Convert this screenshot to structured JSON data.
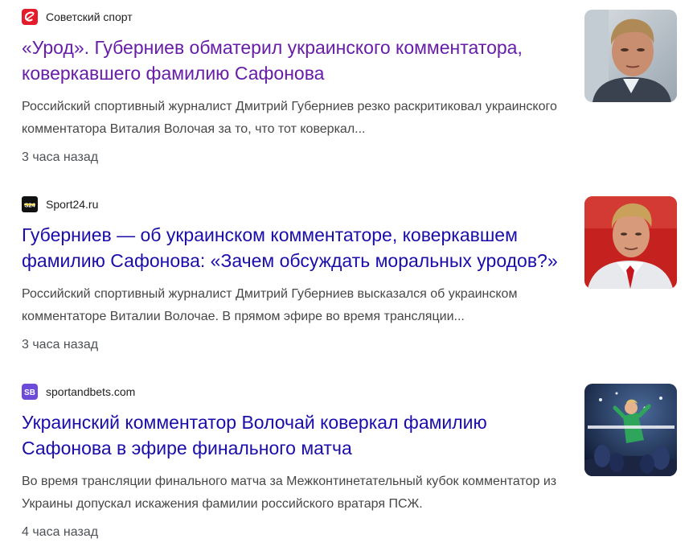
{
  "results": [
    {
      "source": "Советский спорт",
      "favicon_icon": "sovsport-icon",
      "favicon_color": "#e41b2b",
      "title": "«Урод». Губерниев обматерил украинского комментатора, коверкавшего фамилию Сафонова",
      "title_color": "#681da8",
      "snippet": "Российский спортивный журналист Дмитрий Губерниев резко раскритиковал украинского комментатора Виталия Волочая за то, что тот коверкал...",
      "time": "3 часа назад"
    },
    {
      "source": "Sport24.ru",
      "favicon_icon": "sport24-icon",
      "favicon_color": "#111111",
      "title": "Губерниев — об украинском комментаторе, коверкавшем фамилию Сафонова: «Зачем обсуждать моральных уродов?»",
      "title_color": "#1a0dab",
      "snippet": "Российский спортивный журналист Дмитрий Губерниев высказался об украинском комментаторе Виталии Волочае. В прямом эфире во время трансляции...",
      "time": "3 часа назад"
    },
    {
      "source": "sportandbets.com",
      "favicon_icon": "sportandbets-icon",
      "favicon_color": "#6c4bd8",
      "title": "Украинский комментатор Волочай коверкал фамилию Сафонова в эфире финального матча",
      "title_color": "#1a0dab",
      "snippet": "Во время трансляции финального матча за Межконтинетательный кубок комментатор из Украины допускал искажения фамилии российского вратаря ПСЖ.",
      "time": "4 часа назад"
    }
  ]
}
